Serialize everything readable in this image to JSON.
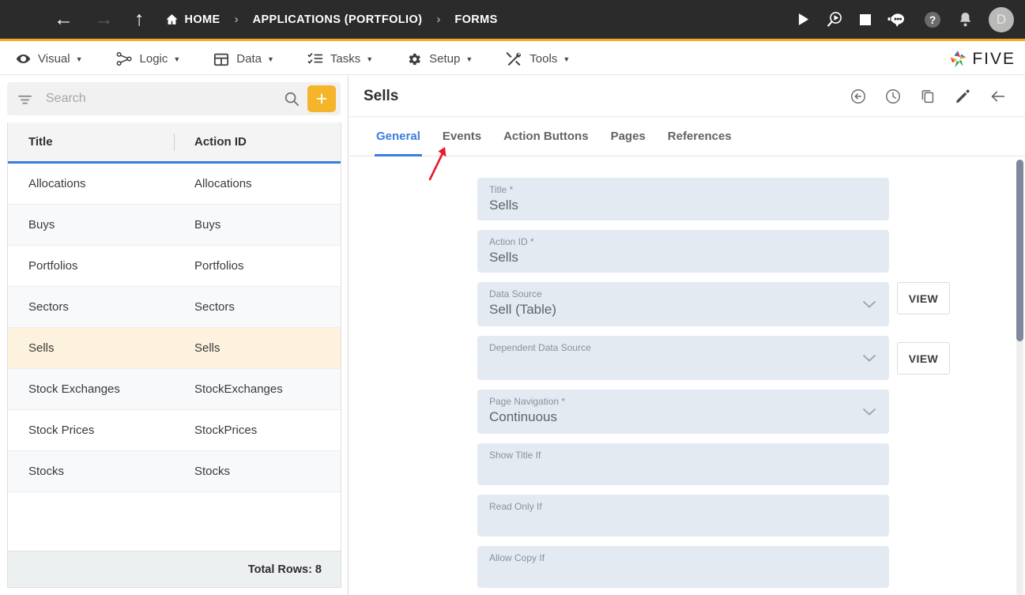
{
  "topbar": {
    "icons": {
      "menu": "hamburger-icon",
      "back": "back-arrow-icon",
      "forward": "forward-arrow-icon",
      "up": "up-arrow-icon",
      "home": "home-icon"
    },
    "breadcrumb": [
      {
        "label": "HOME",
        "icon": "home-icon"
      },
      {
        "label": "APPLICATIONS (PORTFOLIO)"
      },
      {
        "label": "FORMS"
      }
    ],
    "separator": "›",
    "right_icons": [
      {
        "name": "run-play-icon",
        "title": "Run"
      },
      {
        "name": "debug-icon",
        "title": "Debug"
      },
      {
        "name": "stop-icon",
        "title": "Stop"
      },
      {
        "name": "bot-icon",
        "title": "Assistant"
      },
      {
        "name": "help-icon",
        "title": "Help"
      },
      {
        "name": "bell-icon",
        "title": "Notifications"
      }
    ],
    "avatar_initial": "D"
  },
  "menubar": {
    "items": [
      {
        "label": "Visual",
        "icon": "eye-icon"
      },
      {
        "label": "Logic",
        "icon": "logic-nodes-icon"
      },
      {
        "label": "Data",
        "icon": "table-grid-icon"
      },
      {
        "label": "Tasks",
        "icon": "checklist-icon"
      },
      {
        "label": "Setup",
        "icon": "gear-icon"
      },
      {
        "label": "Tools",
        "icon": "tools-icon"
      }
    ],
    "caret": "▼",
    "logo_text": "FIVE"
  },
  "sidebar": {
    "search": {
      "placeholder": "Search",
      "value": ""
    },
    "add_button_label": "+",
    "grid": {
      "columns": [
        "Title",
        "Action ID"
      ],
      "rows": [
        {
          "title": "Allocations",
          "action_id": "Allocations",
          "selected": false
        },
        {
          "title": "Buys",
          "action_id": "Buys",
          "selected": false
        },
        {
          "title": "Portfolios",
          "action_id": "Portfolios",
          "selected": false
        },
        {
          "title": "Sectors",
          "action_id": "Sectors",
          "selected": false
        },
        {
          "title": "Sells",
          "action_id": "Sells",
          "selected": true
        },
        {
          "title": "Stock Exchanges",
          "action_id": "StockExchanges",
          "selected": false
        },
        {
          "title": "Stock Prices",
          "action_id": "StockPrices",
          "selected": false
        },
        {
          "title": "Stocks",
          "action_id": "Stocks",
          "selected": false
        }
      ],
      "footer_label": "Total Rows: 8"
    }
  },
  "detail": {
    "title": "Sells",
    "header_actions": [
      {
        "name": "revert-icon",
        "title": "Revert"
      },
      {
        "name": "history-icon",
        "title": "History"
      },
      {
        "name": "copy-icon",
        "title": "Duplicate"
      },
      {
        "name": "edit-pencil-icon",
        "title": "Edit"
      },
      {
        "name": "close-back-icon",
        "title": "Back"
      }
    ],
    "tabs": [
      {
        "label": "General",
        "active": true
      },
      {
        "label": "Events",
        "active": false
      },
      {
        "label": "Action Buttons",
        "active": false
      },
      {
        "label": "Pages",
        "active": false
      },
      {
        "label": "References",
        "active": false
      }
    ],
    "fields": [
      {
        "label": "Title *",
        "value": "Sells",
        "type": "text",
        "view_button": null
      },
      {
        "label": "Action ID *",
        "value": "Sells",
        "type": "text",
        "view_button": null
      },
      {
        "label": "Data Source",
        "value": "Sell (Table)",
        "type": "select",
        "view_button": "VIEW"
      },
      {
        "label": "Dependent Data Source",
        "value": "",
        "type": "select",
        "view_button": "VIEW"
      },
      {
        "label": "Page Navigation *",
        "value": "Continuous",
        "type": "select",
        "view_button": null
      },
      {
        "label": "Show Title If",
        "value": "",
        "type": "text",
        "view_button": null
      },
      {
        "label": "Read Only If",
        "value": "",
        "type": "text",
        "view_button": null
      },
      {
        "label": "Allow Copy If",
        "value": "",
        "type": "text",
        "view_button": null
      }
    ]
  },
  "annotation": {
    "arrow_color": "#e8192c",
    "points_to": "Events"
  },
  "colors": {
    "accent_yellow": "#f5ab1d",
    "accent_blue": "#3b7ddd",
    "topbar_dark": "#2b2b2b",
    "field_bg": "#e4eaf2",
    "selected_row": "#fdf2de"
  }
}
